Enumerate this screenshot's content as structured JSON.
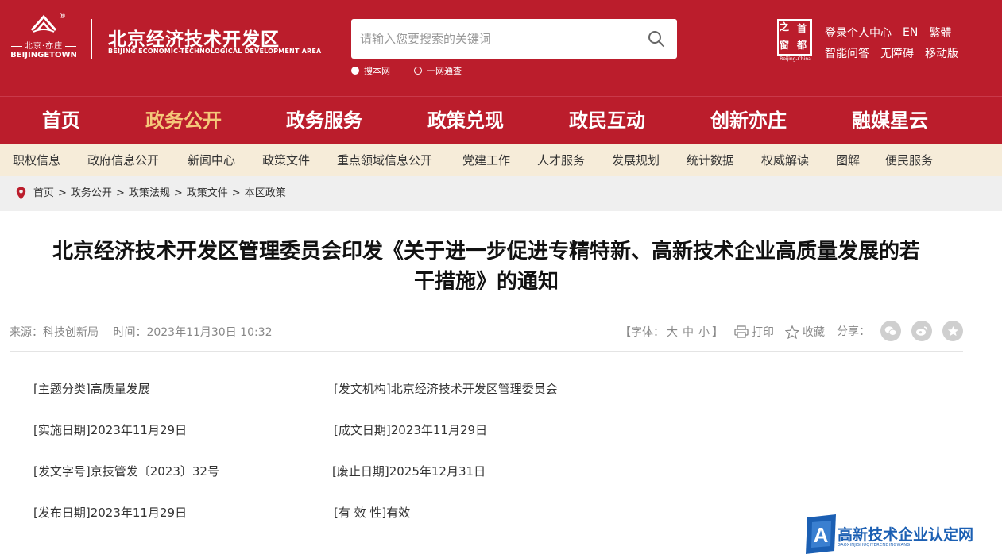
{
  "header": {
    "logo_emblem_cn": "北京·亦庄",
    "logo_emblem_en": "BEIJINGETOWN",
    "site_title": "北京经济技术开发区",
    "site_subtitle": "BEIJING ECONOMIC-TECHNOLOGICAL DEVELOPMENT AREA",
    "search_placeholder": "请输入您要搜索的关键词",
    "search_scopes": [
      {
        "label": "搜本网",
        "selected": true
      },
      {
        "label": "一网通查",
        "selected": false
      }
    ],
    "capital_logo_chars": [
      "之",
      "首",
      "窗",
      "都"
    ],
    "capital_logo_sub": "Beijing-China",
    "top_links_row1": [
      "登录个人中心",
      "EN",
      "繁體"
    ],
    "top_links_row2": [
      "智能问答",
      "无障碍",
      "移动版"
    ]
  },
  "main_nav": {
    "items": [
      "首页",
      "政务公开",
      "政务服务",
      "政策兑现",
      "政民互动",
      "创新亦庄",
      "融媒星云"
    ],
    "active_index": 1
  },
  "sub_nav": {
    "items": [
      "职权信息",
      "政府信息公开",
      "新闻中心",
      "政策文件",
      "重点领域信息公开",
      "党建工作",
      "人才服务",
      "发展规划",
      "统计数据",
      "权威解读",
      "图解",
      "便民服务"
    ]
  },
  "breadcrumb": {
    "items": [
      "首页",
      "政务公开",
      "政策法规",
      "政策文件",
      "本区政策"
    ],
    "separator": ">"
  },
  "article": {
    "title_line1": "北京经济技术开发区管理委员会印发《关于进一步促进专精特新、高新技术企业高质量发展的若",
    "title_line2": "干措施》的通知",
    "source": "来源：科技创新局",
    "time": "时间：2023年11月30日 10:32",
    "font_size_label": "【字体：",
    "font_sizes": [
      "大",
      "中",
      "小"
    ],
    "font_size_close": "】",
    "print_label": "打印",
    "favorite_label": "收藏",
    "share_label": "分享："
  },
  "info": {
    "topic_label": "[主题分类]",
    "topic_value": "高质量发展",
    "issuer_label": "[发文机构]",
    "issuer_value": "北京经济技术开发区管理委员会",
    "effective_label": "[实施日期]",
    "effective_value": "2023年11月29日",
    "written_label": "[成文日期]",
    "written_value": "2023年11月29日",
    "docno_label": "[发文字号]",
    "docno_value": "京技管发〔2023〕32号",
    "expire_label": "[废止日期]",
    "expire_value": "2025年12月31日",
    "publish_label": "[发布日期]",
    "publish_value": "2023年11月29日",
    "validity_label": "[有 效 性]",
    "validity_value": "有效"
  },
  "watermark": {
    "text": "高新技术企业认定网",
    "sub": "GAOXINJISHUQIYERENDINGWANG"
  },
  "colors": {
    "brand_red": "#bb1d2c",
    "active_nav": "#f5c87a",
    "subnav_bg": "#f6ecd9",
    "breadcrumb_bg": "#efefef",
    "watermark_blue": "#1b5fb3"
  }
}
